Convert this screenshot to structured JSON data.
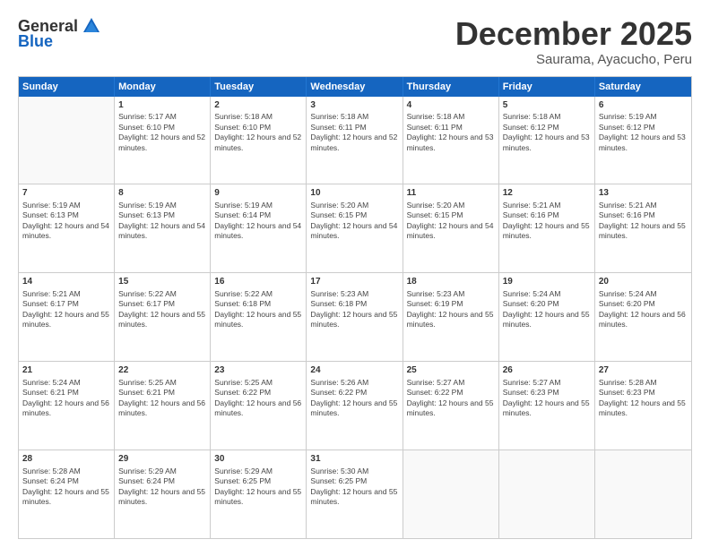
{
  "logo": {
    "general": "General",
    "blue": "Blue"
  },
  "title": "December 2025",
  "subtitle": "Saurama, Ayacucho, Peru",
  "header_days": [
    "Sunday",
    "Monday",
    "Tuesday",
    "Wednesday",
    "Thursday",
    "Friday",
    "Saturday"
  ],
  "weeks": [
    [
      {
        "day": "",
        "empty": true
      },
      {
        "day": "1",
        "sunrise": "Sunrise: 5:17 AM",
        "sunset": "Sunset: 6:10 PM",
        "daylight": "Daylight: 12 hours and 52 minutes."
      },
      {
        "day": "2",
        "sunrise": "Sunrise: 5:18 AM",
        "sunset": "Sunset: 6:10 PM",
        "daylight": "Daylight: 12 hours and 52 minutes."
      },
      {
        "day": "3",
        "sunrise": "Sunrise: 5:18 AM",
        "sunset": "Sunset: 6:11 PM",
        "daylight": "Daylight: 12 hours and 52 minutes."
      },
      {
        "day": "4",
        "sunrise": "Sunrise: 5:18 AM",
        "sunset": "Sunset: 6:11 PM",
        "daylight": "Daylight: 12 hours and 53 minutes."
      },
      {
        "day": "5",
        "sunrise": "Sunrise: 5:18 AM",
        "sunset": "Sunset: 6:12 PM",
        "daylight": "Daylight: 12 hours and 53 minutes."
      },
      {
        "day": "6",
        "sunrise": "Sunrise: 5:19 AM",
        "sunset": "Sunset: 6:12 PM",
        "daylight": "Daylight: 12 hours and 53 minutes."
      }
    ],
    [
      {
        "day": "7",
        "sunrise": "Sunrise: 5:19 AM",
        "sunset": "Sunset: 6:13 PM",
        "daylight": "Daylight: 12 hours and 54 minutes."
      },
      {
        "day": "8",
        "sunrise": "Sunrise: 5:19 AM",
        "sunset": "Sunset: 6:13 PM",
        "daylight": "Daylight: 12 hours and 54 minutes."
      },
      {
        "day": "9",
        "sunrise": "Sunrise: 5:19 AM",
        "sunset": "Sunset: 6:14 PM",
        "daylight": "Daylight: 12 hours and 54 minutes."
      },
      {
        "day": "10",
        "sunrise": "Sunrise: 5:20 AM",
        "sunset": "Sunset: 6:15 PM",
        "daylight": "Daylight: 12 hours and 54 minutes."
      },
      {
        "day": "11",
        "sunrise": "Sunrise: 5:20 AM",
        "sunset": "Sunset: 6:15 PM",
        "daylight": "Daylight: 12 hours and 54 minutes."
      },
      {
        "day": "12",
        "sunrise": "Sunrise: 5:21 AM",
        "sunset": "Sunset: 6:16 PM",
        "daylight": "Daylight: 12 hours and 55 minutes."
      },
      {
        "day": "13",
        "sunrise": "Sunrise: 5:21 AM",
        "sunset": "Sunset: 6:16 PM",
        "daylight": "Daylight: 12 hours and 55 minutes."
      }
    ],
    [
      {
        "day": "14",
        "sunrise": "Sunrise: 5:21 AM",
        "sunset": "Sunset: 6:17 PM",
        "daylight": "Daylight: 12 hours and 55 minutes."
      },
      {
        "day": "15",
        "sunrise": "Sunrise: 5:22 AM",
        "sunset": "Sunset: 6:17 PM",
        "daylight": "Daylight: 12 hours and 55 minutes."
      },
      {
        "day": "16",
        "sunrise": "Sunrise: 5:22 AM",
        "sunset": "Sunset: 6:18 PM",
        "daylight": "Daylight: 12 hours and 55 minutes."
      },
      {
        "day": "17",
        "sunrise": "Sunrise: 5:23 AM",
        "sunset": "Sunset: 6:18 PM",
        "daylight": "Daylight: 12 hours and 55 minutes."
      },
      {
        "day": "18",
        "sunrise": "Sunrise: 5:23 AM",
        "sunset": "Sunset: 6:19 PM",
        "daylight": "Daylight: 12 hours and 55 minutes."
      },
      {
        "day": "19",
        "sunrise": "Sunrise: 5:24 AM",
        "sunset": "Sunset: 6:20 PM",
        "daylight": "Daylight: 12 hours and 55 minutes."
      },
      {
        "day": "20",
        "sunrise": "Sunrise: 5:24 AM",
        "sunset": "Sunset: 6:20 PM",
        "daylight": "Daylight: 12 hours and 56 minutes."
      }
    ],
    [
      {
        "day": "21",
        "sunrise": "Sunrise: 5:24 AM",
        "sunset": "Sunset: 6:21 PM",
        "daylight": "Daylight: 12 hours and 56 minutes."
      },
      {
        "day": "22",
        "sunrise": "Sunrise: 5:25 AM",
        "sunset": "Sunset: 6:21 PM",
        "daylight": "Daylight: 12 hours and 56 minutes."
      },
      {
        "day": "23",
        "sunrise": "Sunrise: 5:25 AM",
        "sunset": "Sunset: 6:22 PM",
        "daylight": "Daylight: 12 hours and 56 minutes."
      },
      {
        "day": "24",
        "sunrise": "Sunrise: 5:26 AM",
        "sunset": "Sunset: 6:22 PM",
        "daylight": "Daylight: 12 hours and 55 minutes."
      },
      {
        "day": "25",
        "sunrise": "Sunrise: 5:27 AM",
        "sunset": "Sunset: 6:22 PM",
        "daylight": "Daylight: 12 hours and 55 minutes."
      },
      {
        "day": "26",
        "sunrise": "Sunrise: 5:27 AM",
        "sunset": "Sunset: 6:23 PM",
        "daylight": "Daylight: 12 hours and 55 minutes."
      },
      {
        "day": "27",
        "sunrise": "Sunrise: 5:28 AM",
        "sunset": "Sunset: 6:23 PM",
        "daylight": "Daylight: 12 hours and 55 minutes."
      }
    ],
    [
      {
        "day": "28",
        "sunrise": "Sunrise: 5:28 AM",
        "sunset": "Sunset: 6:24 PM",
        "daylight": "Daylight: 12 hours and 55 minutes."
      },
      {
        "day": "29",
        "sunrise": "Sunrise: 5:29 AM",
        "sunset": "Sunset: 6:24 PM",
        "daylight": "Daylight: 12 hours and 55 minutes."
      },
      {
        "day": "30",
        "sunrise": "Sunrise: 5:29 AM",
        "sunset": "Sunset: 6:25 PM",
        "daylight": "Daylight: 12 hours and 55 minutes."
      },
      {
        "day": "31",
        "sunrise": "Sunrise: 5:30 AM",
        "sunset": "Sunset: 6:25 PM",
        "daylight": "Daylight: 12 hours and 55 minutes."
      },
      {
        "day": "",
        "empty": true
      },
      {
        "day": "",
        "empty": true
      },
      {
        "day": "",
        "empty": true
      }
    ]
  ]
}
